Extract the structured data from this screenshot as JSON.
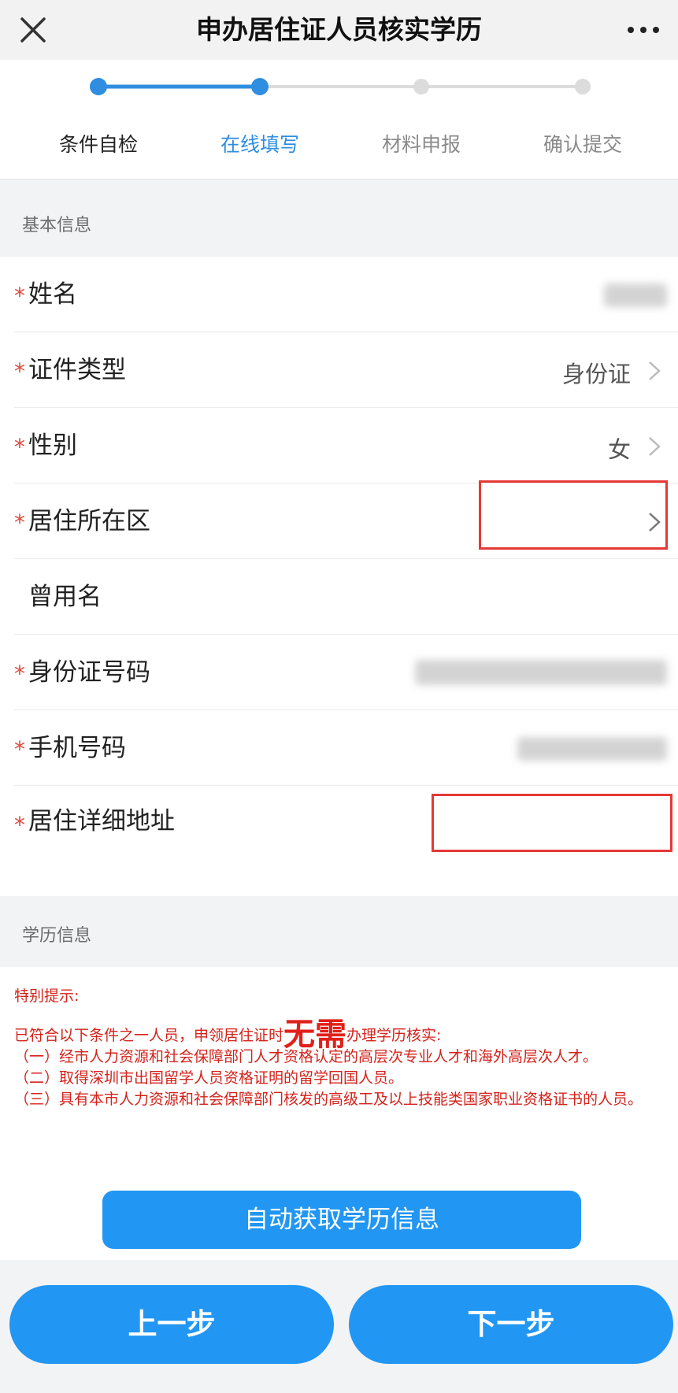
{
  "nav": {
    "title": "申办居住证人员核实学历",
    "close_icon": "close-icon",
    "more_icon": "more-icon"
  },
  "steps": {
    "items": [
      {
        "label": "条件自检",
        "state": "done"
      },
      {
        "label": "在线填写",
        "state": "current"
      },
      {
        "label": "材料申报",
        "state": "pending"
      },
      {
        "label": "确认提交",
        "state": "pending"
      }
    ],
    "active_color": "#2f8ee0",
    "pending_color": "#d0d0d0"
  },
  "basic": {
    "section_title": "基本信息",
    "fields": [
      {
        "label": "姓名",
        "required": true,
        "value": ""
      },
      {
        "label": "证件类型",
        "required": true,
        "value": "身份证"
      },
      {
        "label": "性别",
        "required": true,
        "value": "女"
      },
      {
        "label": "居住所在区",
        "required": true,
        "value": ""
      },
      {
        "label": "曾用名",
        "required": false,
        "value": ""
      },
      {
        "label": "身份证号码",
        "required": true,
        "value": ""
      },
      {
        "label": "手机号码",
        "required": true,
        "value": ""
      },
      {
        "label": "居住详细地址",
        "required": true,
        "value": ""
      }
    ],
    "required_mark": "*"
  },
  "education": {
    "section_title": "学历信息",
    "notice_title": "特别提示:",
    "notice_prefix": "已符合以下条件之一人员，申领居住证时",
    "notice_emphasis": "无需",
    "notice_suffix": "办理学历核实:",
    "notice_items": [
      "（一）经市人力资源和社会保障部门人才资格认定的高层次专业人才和海外高层次人才。",
      "（二）取得深圳市出国留学人员资格证明的留学回国人员。",
      "（三）具有本市人力资源和社会保障部门核发的高级工及以上技能类国家职业资格证书的人员。"
    ],
    "auto_fetch_label": "自动获取学历信息"
  },
  "footer": {
    "prev_label": "上一步",
    "next_label": "下一步"
  },
  "colors": {
    "primary": "#2196f3",
    "required": "#e0493b",
    "notice": "#d3231b",
    "highlight": "#e53935"
  }
}
